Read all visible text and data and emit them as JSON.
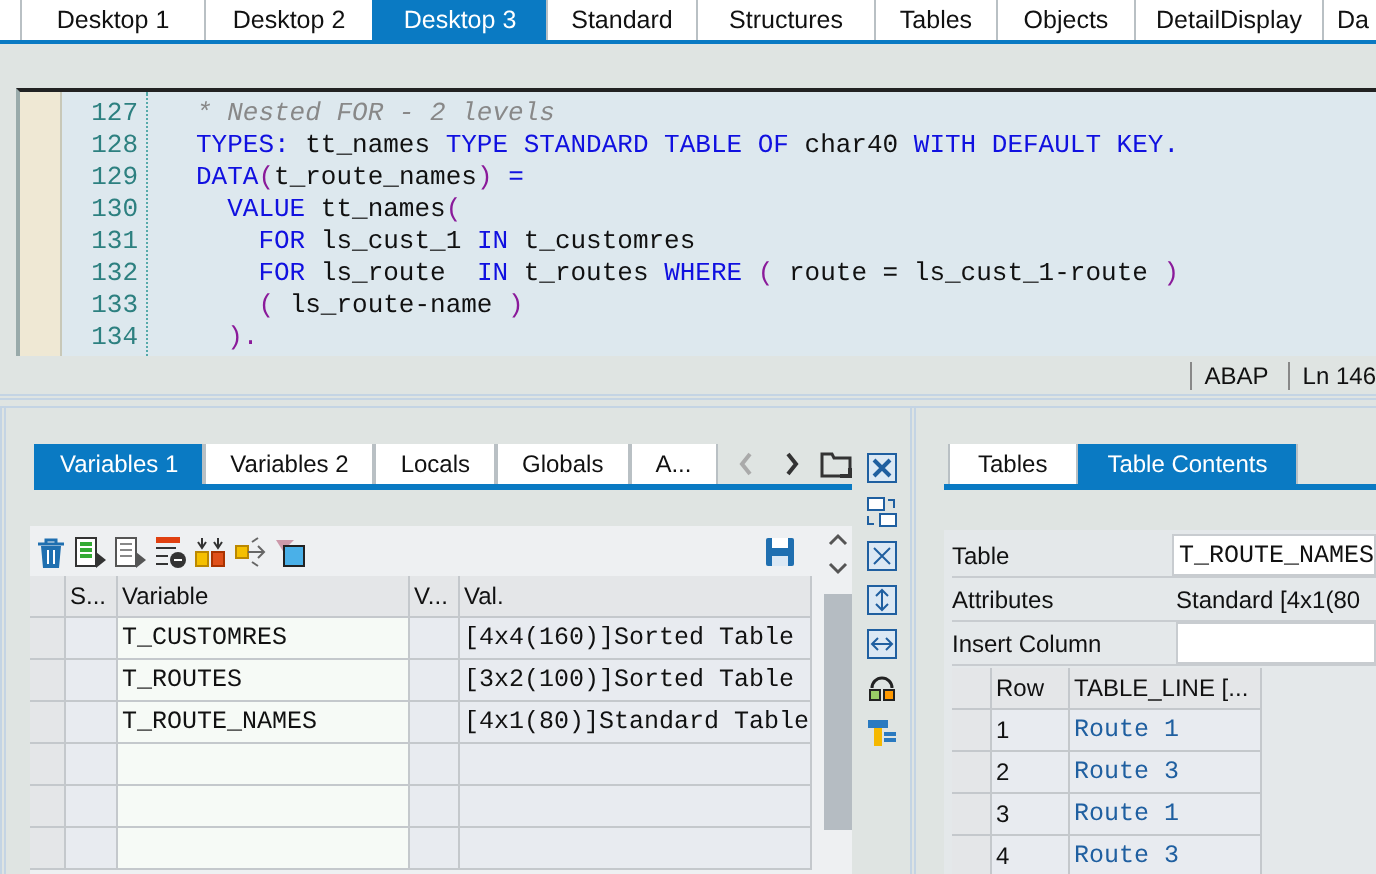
{
  "desktop_tabs": [
    {
      "label": "Desktop 1",
      "selected": false
    },
    {
      "label": "Desktop 2",
      "selected": false
    },
    {
      "label": "Desktop 3",
      "selected": true
    },
    {
      "label": "Standard",
      "selected": false
    },
    {
      "label": "Structures",
      "selected": false
    },
    {
      "label": "Tables",
      "selected": false
    },
    {
      "label": "Objects",
      "selected": false
    },
    {
      "label": "DetailDisplay",
      "selected": false
    },
    {
      "label": "Da",
      "selected": false
    }
  ],
  "editor": {
    "lines": [
      {
        "number": "127",
        "tokens": [
          {
            "kind": "comment",
            "text": "* Nested FOR - 2 levels"
          }
        ]
      },
      {
        "number": "128",
        "tokens": [
          {
            "kind": "keyword",
            "text": "TYPES:"
          },
          {
            "kind": "plain",
            "text": " tt_names "
          },
          {
            "kind": "keyword",
            "text": "TYPE STANDARD TABLE OF"
          },
          {
            "kind": "plain",
            "text": " char40 "
          },
          {
            "kind": "keyword",
            "text": "WITH DEFAULT KEY."
          }
        ]
      },
      {
        "number": "129",
        "tokens": [
          {
            "kind": "keyword",
            "text": "DATA"
          },
          {
            "kind": "paren",
            "text": "("
          },
          {
            "kind": "plain",
            "text": "t_route_names"
          },
          {
            "kind": "paren",
            "text": ")"
          },
          {
            "kind": "keyword",
            "text": " ="
          }
        ]
      },
      {
        "number": "130",
        "tokens": [
          {
            "kind": "keyword",
            "text": "  VALUE"
          },
          {
            "kind": "plain",
            "text": " tt_names"
          },
          {
            "kind": "paren",
            "text": "("
          }
        ]
      },
      {
        "number": "131",
        "tokens": [
          {
            "kind": "keyword",
            "text": "    FOR"
          },
          {
            "kind": "plain",
            "text": " ls_cust_1 "
          },
          {
            "kind": "keyword",
            "text": "IN"
          },
          {
            "kind": "plain",
            "text": " t_customres"
          }
        ]
      },
      {
        "number": "132",
        "tokens": [
          {
            "kind": "keyword",
            "text": "    FOR"
          },
          {
            "kind": "plain",
            "text": " ls_route  "
          },
          {
            "kind": "keyword",
            "text": "IN"
          },
          {
            "kind": "plain",
            "text": " t_routes "
          },
          {
            "kind": "keyword",
            "text": "WHERE"
          },
          {
            "kind": "paren",
            "text": " ("
          },
          {
            "kind": "plain",
            "text": " route = ls_cust_1-route "
          },
          {
            "kind": "paren",
            "text": ")"
          }
        ]
      },
      {
        "number": "133",
        "tokens": [
          {
            "kind": "paren",
            "text": "    ("
          },
          {
            "kind": "plain",
            "text": " ls_route-name "
          },
          {
            "kind": "paren",
            "text": ")"
          }
        ]
      },
      {
        "number": "134",
        "tokens": [
          {
            "kind": "paren",
            "text": "  )."
          }
        ]
      }
    ]
  },
  "status_bar": {
    "language": "ABAP",
    "position": "Ln 146"
  },
  "variables_panel": {
    "tabs": [
      {
        "label": "Variables 1",
        "selected": true
      },
      {
        "label": "Variables 2",
        "selected": false
      },
      {
        "label": "Locals",
        "selected": false
      },
      {
        "label": "Globals",
        "selected": false
      },
      {
        "label": "A...",
        "selected": false
      }
    ],
    "columns": [
      "S...",
      "Variable",
      "V...",
      "Val."
    ],
    "rows": [
      {
        "variable": "T_CUSTOMRES",
        "value": "[4x4(160)]Sorted Table"
      },
      {
        "variable": "T_ROUTES",
        "value": "[3x2(100)]Sorted Table"
      },
      {
        "variable": "T_ROUTE_NAMES",
        "value": "[4x1(80)]Standard Table"
      }
    ]
  },
  "table_panel": {
    "tabs": [
      {
        "label": "Tables",
        "selected": false
      },
      {
        "label": "Table Contents",
        "selected": true
      }
    ],
    "fields": [
      {
        "kind": "input",
        "label": "Table",
        "value": "T_ROUTE_NAMES"
      },
      {
        "kind": "text",
        "label": "Attributes",
        "value": "Standard [4x1(80"
      },
      {
        "kind": "input",
        "label": "Insert Column"
      }
    ],
    "columns": [
      "Row",
      "TABLE_LINE [..."
    ],
    "rows": [
      {
        "row": "1",
        "line": "Route 1"
      },
      {
        "row": "2",
        "line": "Route 3"
      },
      {
        "row": "3",
        "line": "Route 1"
      },
      {
        "row": "4",
        "line": "Route 3"
      }
    ]
  }
}
